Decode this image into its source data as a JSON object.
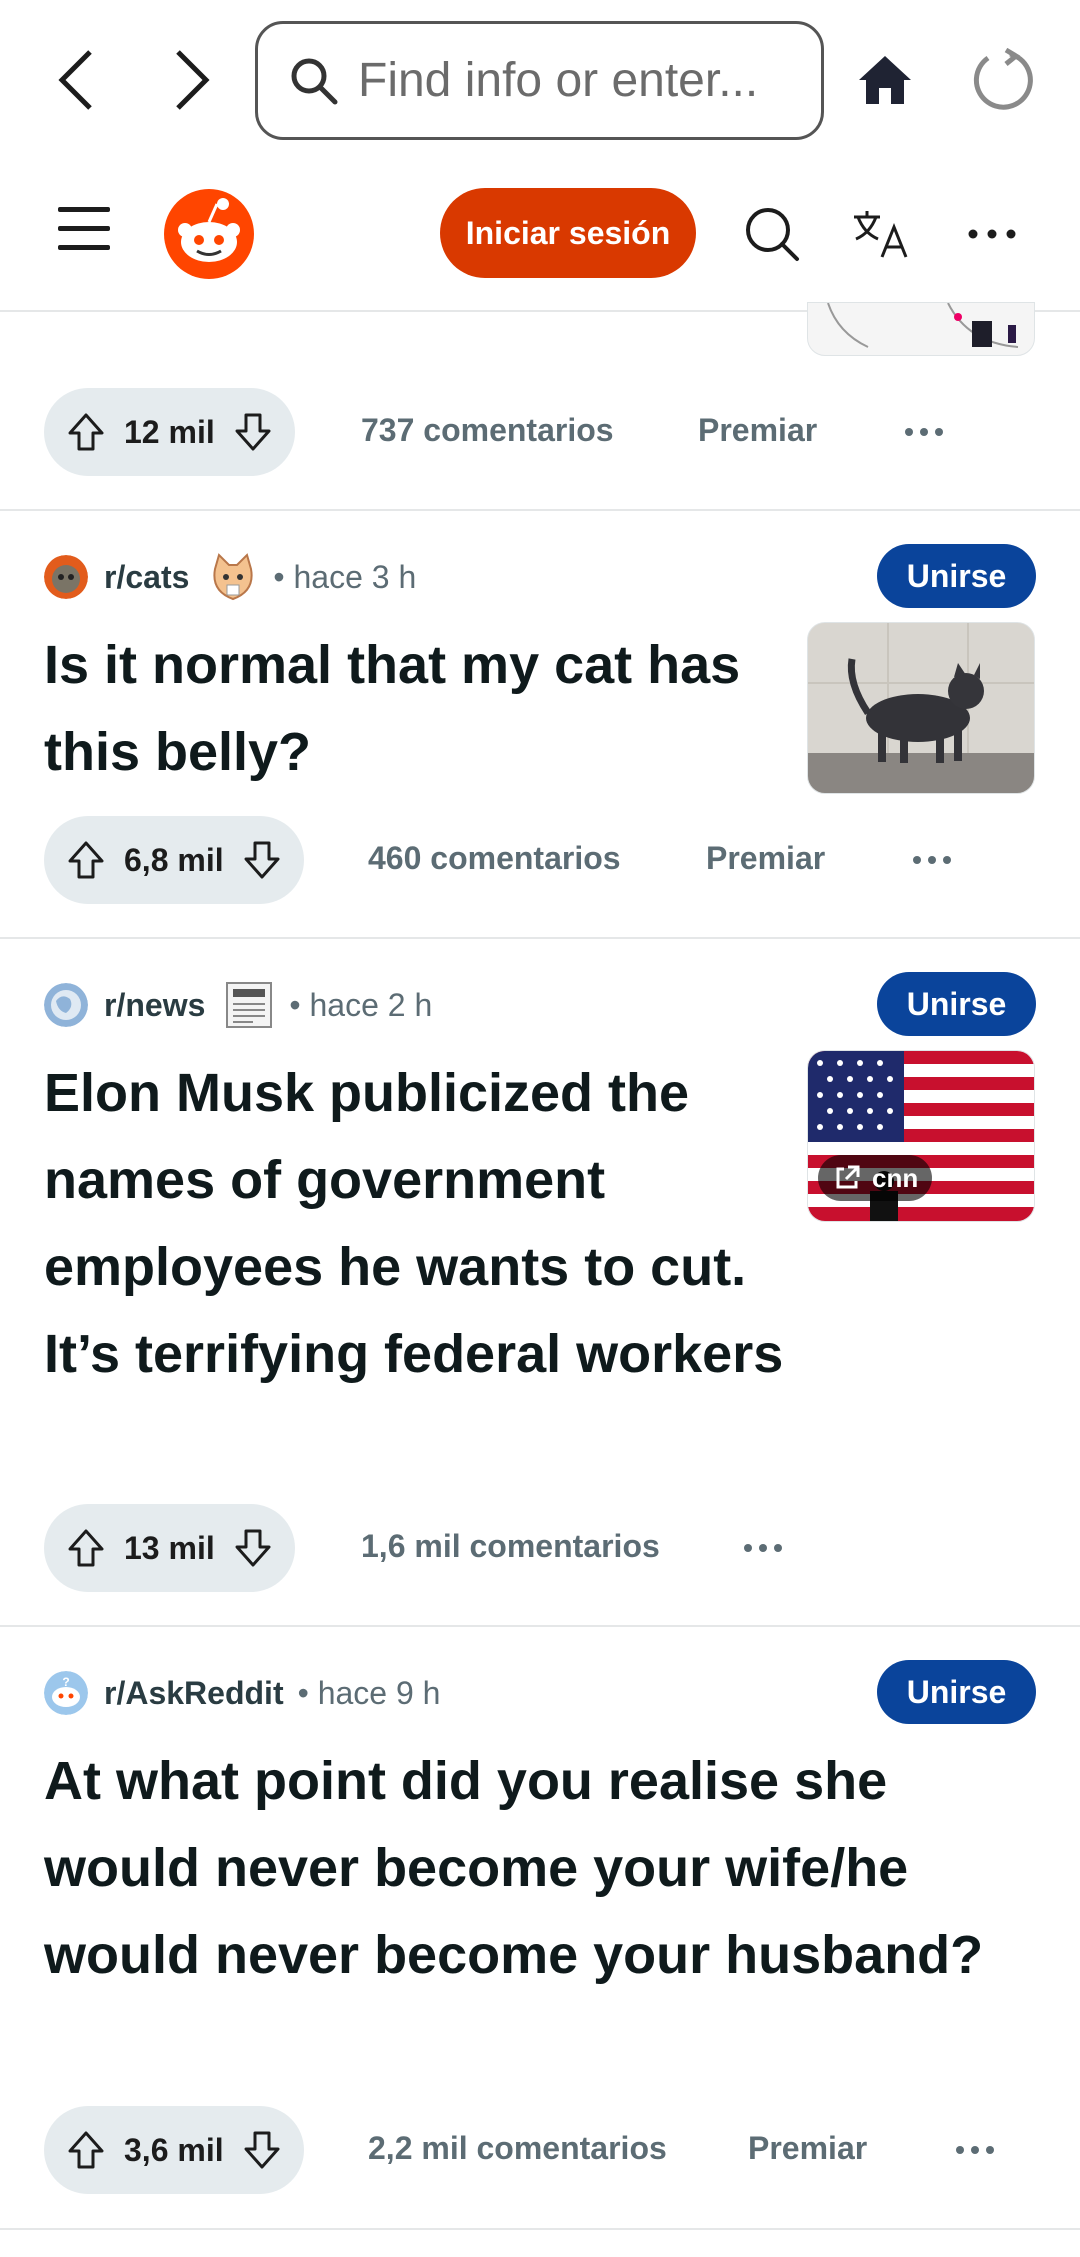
{
  "browser": {
    "url_placeholder": "Find info or enter..."
  },
  "header": {
    "login_label": "Iniciar sesión",
    "colors": {
      "brand": "#d93900",
      "join": "#0a449b"
    }
  },
  "top_partial": {
    "votes": "12 mil",
    "comments": "737 comentarios",
    "award": "Premiar"
  },
  "posts": [
    {
      "subreddit": "r/cats",
      "time": "• hace 3 h",
      "join": "Unirse",
      "title": "Is it normal that my cat has this belly?",
      "votes": "6,8 mil",
      "comments": "460 comentarios",
      "award": "Premiar"
    },
    {
      "subreddit": "r/news",
      "time": "• hace 2 h",
      "join": "Unirse",
      "title": "Elon Musk publicized the names of government employees he wants to cut. It’s terrifying federal workers",
      "link_domain": "cnn",
      "votes": "13 mil",
      "comments": "1,6 mil comentarios"
    },
    {
      "subreddit": "r/AskReddit",
      "time": "• hace 9 h",
      "join": "Unirse",
      "title": "At what point did you realise she would never become your wife/he would never become your husband?",
      "votes": "3,6 mil",
      "comments": "2,2 mil comentarios",
      "award": "Premiar"
    }
  ]
}
